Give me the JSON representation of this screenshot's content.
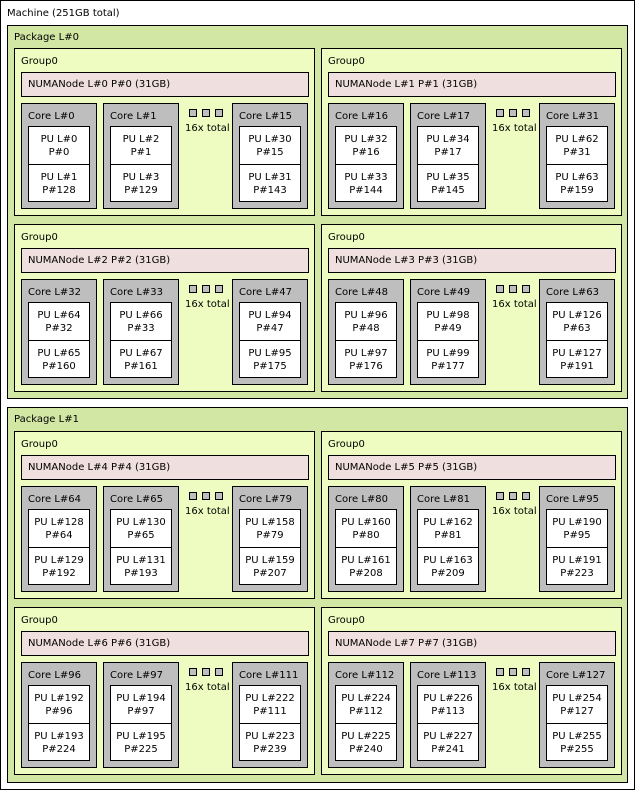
{
  "machine": {
    "label": "Machine (251GB total)"
  },
  "more_label": "16x total",
  "packages": [
    {
      "label": "Package L#0",
      "groups": [
        {
          "label": "Group0",
          "numa": "NUMANode L#0 P#0 (31GB)",
          "cores": [
            {
              "label": "Core L#0",
              "pus": [
                {
                  "l": "PU L#0",
                  "p": "P#0"
                },
                {
                  "l": "PU L#1",
                  "p": "P#128"
                }
              ]
            },
            {
              "label": "Core L#1",
              "pus": [
                {
                  "l": "PU L#2",
                  "p": "P#1"
                },
                {
                  "l": "PU L#3",
                  "p": "P#129"
                }
              ]
            },
            {
              "label": "Core L#15",
              "pus": [
                {
                  "l": "PU L#30",
                  "p": "P#15"
                },
                {
                  "l": "PU L#31",
                  "p": "P#143"
                }
              ]
            }
          ]
        },
        {
          "label": "Group0",
          "numa": "NUMANode L#1 P#1 (31GB)",
          "cores": [
            {
              "label": "Core L#16",
              "pus": [
                {
                  "l": "PU L#32",
                  "p": "P#16"
                },
                {
                  "l": "PU L#33",
                  "p": "P#144"
                }
              ]
            },
            {
              "label": "Core L#17",
              "pus": [
                {
                  "l": "PU L#34",
                  "p": "P#17"
                },
                {
                  "l": "PU L#35",
                  "p": "P#145"
                }
              ]
            },
            {
              "label": "Core L#31",
              "pus": [
                {
                  "l": "PU L#62",
                  "p": "P#31"
                },
                {
                  "l": "PU L#63",
                  "p": "P#159"
                }
              ]
            }
          ]
        },
        {
          "label": "Group0",
          "numa": "NUMANode L#2 P#2 (31GB)",
          "cores": [
            {
              "label": "Core L#32",
              "pus": [
                {
                  "l": "PU L#64",
                  "p": "P#32"
                },
                {
                  "l": "PU L#65",
                  "p": "P#160"
                }
              ]
            },
            {
              "label": "Core L#33",
              "pus": [
                {
                  "l": "PU L#66",
                  "p": "P#33"
                },
                {
                  "l": "PU L#67",
                  "p": "P#161"
                }
              ]
            },
            {
              "label": "Core L#47",
              "pus": [
                {
                  "l": "PU L#94",
                  "p": "P#47"
                },
                {
                  "l": "PU L#95",
                  "p": "P#175"
                }
              ]
            }
          ]
        },
        {
          "label": "Group0",
          "numa": "NUMANode L#3 P#3 (31GB)",
          "cores": [
            {
              "label": "Core L#48",
              "pus": [
                {
                  "l": "PU L#96",
                  "p": "P#48"
                },
                {
                  "l": "PU L#97",
                  "p": "P#176"
                }
              ]
            },
            {
              "label": "Core L#49",
              "pus": [
                {
                  "l": "PU L#98",
                  "p": "P#49"
                },
                {
                  "l": "PU L#99",
                  "p": "P#177"
                }
              ]
            },
            {
              "label": "Core L#63",
              "pus": [
                {
                  "l": "PU L#126",
                  "p": "P#63"
                },
                {
                  "l": "PU L#127",
                  "p": "P#191"
                }
              ]
            }
          ]
        }
      ]
    },
    {
      "label": "Package L#1",
      "groups": [
        {
          "label": "Group0",
          "numa": "NUMANode L#4 P#4 (31GB)",
          "cores": [
            {
              "label": "Core L#64",
              "pus": [
                {
                  "l": "PU L#128",
                  "p": "P#64"
                },
                {
                  "l": "PU L#129",
                  "p": "P#192"
                }
              ]
            },
            {
              "label": "Core L#65",
              "pus": [
                {
                  "l": "PU L#130",
                  "p": "P#65"
                },
                {
                  "l": "PU L#131",
                  "p": "P#193"
                }
              ]
            },
            {
              "label": "Core L#79",
              "pus": [
                {
                  "l": "PU L#158",
                  "p": "P#79"
                },
                {
                  "l": "PU L#159",
                  "p": "P#207"
                }
              ]
            }
          ]
        },
        {
          "label": "Group0",
          "numa": "NUMANode L#5 P#5 (31GB)",
          "cores": [
            {
              "label": "Core L#80",
              "pus": [
                {
                  "l": "PU L#160",
                  "p": "P#80"
                },
                {
                  "l": "PU L#161",
                  "p": "P#208"
                }
              ]
            },
            {
              "label": "Core L#81",
              "pus": [
                {
                  "l": "PU L#162",
                  "p": "P#81"
                },
                {
                  "l": "PU L#163",
                  "p": "P#209"
                }
              ]
            },
            {
              "label": "Core L#95",
              "pus": [
                {
                  "l": "PU L#190",
                  "p": "P#95"
                },
                {
                  "l": "PU L#191",
                  "p": "P#223"
                }
              ]
            }
          ]
        },
        {
          "label": "Group0",
          "numa": "NUMANode L#6 P#6 (31GB)",
          "cores": [
            {
              "label": "Core L#96",
              "pus": [
                {
                  "l": "PU L#192",
                  "p": "P#96"
                },
                {
                  "l": "PU L#193",
                  "p": "P#224"
                }
              ]
            },
            {
              "label": "Core L#97",
              "pus": [
                {
                  "l": "PU L#194",
                  "p": "P#97"
                },
                {
                  "l": "PU L#195",
                  "p": "P#225"
                }
              ]
            },
            {
              "label": "Core L#111",
              "pus": [
                {
                  "l": "PU L#222",
                  "p": "P#111"
                },
                {
                  "l": "PU L#223",
                  "p": "P#239"
                }
              ]
            }
          ]
        },
        {
          "label": "Group0",
          "numa": "NUMANode L#7 P#7 (31GB)",
          "cores": [
            {
              "label": "Core L#112",
              "pus": [
                {
                  "l": "PU L#224",
                  "p": "P#112"
                },
                {
                  "l": "PU L#225",
                  "p": "P#240"
                }
              ]
            },
            {
              "label": "Core L#113",
              "pus": [
                {
                  "l": "PU L#226",
                  "p": "P#113"
                },
                {
                  "l": "PU L#227",
                  "p": "P#241"
                }
              ]
            },
            {
              "label": "Core L#127",
              "pus": [
                {
                  "l": "PU L#254",
                  "p": "P#127"
                },
                {
                  "l": "PU L#255",
                  "p": "P#255"
                }
              ]
            }
          ]
        }
      ]
    }
  ]
}
